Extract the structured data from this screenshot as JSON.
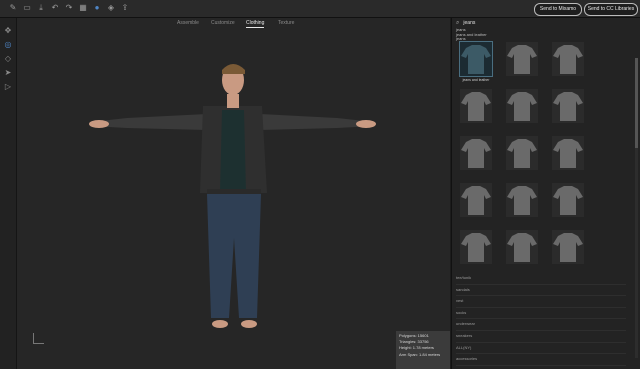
{
  "toolbar": {
    "icons": [
      "pencil-icon",
      "folder-icon",
      "download-icon",
      "undo-icon",
      "redo-icon",
      "redo-icon",
      "settings-icon",
      "layers-icon",
      "export-icon"
    ],
    "send_mixamo": "Send to Mixamo",
    "send_cc": "Send to CC Libraries"
  },
  "tools": [
    "move-icon",
    "orbit-icon",
    "tag-icon",
    "select-icon",
    "play-icon"
  ],
  "tabs": {
    "assemble": "Assemble",
    "customize": "Customize",
    "clothing": "Clothing",
    "texture": "Texture"
  },
  "search": {
    "value": "jeans"
  },
  "suggestions": [
    "jeans",
    "jeans and leather",
    "jeans"
  ],
  "thumbnails": [
    {
      "caption": "jeans and leather",
      "selected": true
    },
    {
      "caption": "",
      "selected": false
    },
    {
      "caption": "",
      "selected": false
    },
    {
      "caption": "",
      "selected": false
    },
    {
      "caption": "",
      "selected": false
    },
    {
      "caption": "",
      "selected": false
    },
    {
      "caption": "",
      "selected": false
    },
    {
      "caption": "",
      "selected": false
    },
    {
      "caption": "",
      "selected": false
    },
    {
      "caption": "",
      "selected": false
    },
    {
      "caption": "",
      "selected": false
    },
    {
      "caption": "",
      "selected": false
    },
    {
      "caption": "",
      "selected": false
    },
    {
      "caption": "",
      "selected": false
    },
    {
      "caption": "",
      "selected": false
    }
  ],
  "list_items": [
    "tee/tunik",
    "sandals",
    "vest",
    "socks",
    "underwear",
    "sneakers",
    "ALL(NY)",
    "accessories"
  ],
  "stats": {
    "polygons": "Polygons: 15601",
    "triangles": "Triangles: 33756",
    "height": "Height: 1.78 meters",
    "arm_span": "Arm Span: 1.84 meters"
  },
  "colors": {
    "accent": "#4a6e80",
    "viewport_bg": "#262626",
    "panel_bg": "#232323"
  }
}
